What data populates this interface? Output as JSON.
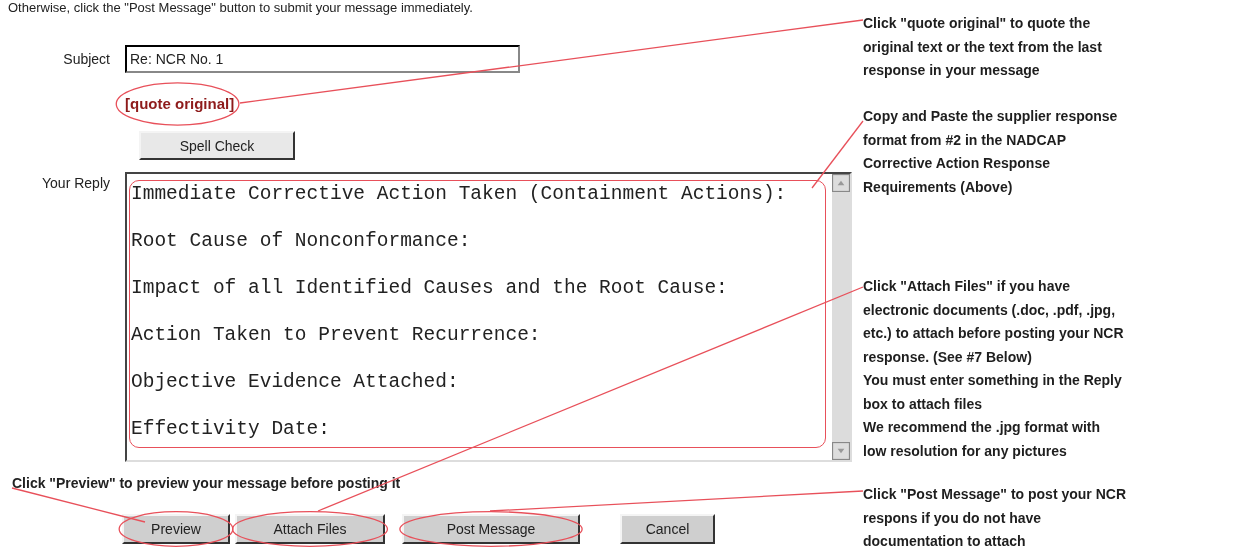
{
  "intro_text": "Otherwise, click the \"Post Message\" button to submit your message immediately.",
  "subject": {
    "label": "Subject",
    "value": "Re: NCR No. 1"
  },
  "quote_link": {
    "label": "[quote original]",
    "circled": true
  },
  "spell_check_button": {
    "label": "Spell Check"
  },
  "reply": {
    "label": "Your Reply",
    "lines": [
      "Immediate Corrective Action Taken (Containment Actions):",
      "Root Cause of Nonconformance:",
      "Impact of all Identified Causes and the Root Cause:",
      "Action Taken to Prevent Recurrence:",
      "Objective Evidence Attached:",
      "Effectivity Date:"
    ],
    "circled": true
  },
  "preview_note": "Click \"Preview\" to preview your message before posting it",
  "buttons": [
    {
      "label": "Preview",
      "circled": true
    },
    {
      "label": "Attach Files",
      "circled": true
    },
    {
      "label": "Post Message",
      "circled": true
    },
    {
      "label": "Cancel",
      "circled": false
    }
  ],
  "callouts": [
    {
      "lines": [
        "Click \"quote original\" to quote the",
        "original text or the text from the last",
        "response in your message"
      ]
    },
    {
      "lines": [
        "Copy and Paste the supplier response",
        "format from #2 in the NADCAP",
        "Corrective Action Response",
        "Requirements (Above)"
      ]
    },
    {
      "lines": [
        "Click \"Attach Files\" if you have",
        "electronic documents (.doc, .pdf, .jpg,",
        "etc.) to attach before posting your NCR",
        "response.  (See #7 Below)",
        "You must enter something in the Reply",
        "box to attach files",
        "We recommend the .jpg format with",
        "low resolution for any pictures"
      ]
    },
    {
      "lines": [
        "Click \"Post Message\" to post your NCR",
        "respons if you do not have",
        "documentation to attach"
      ]
    }
  ]
}
